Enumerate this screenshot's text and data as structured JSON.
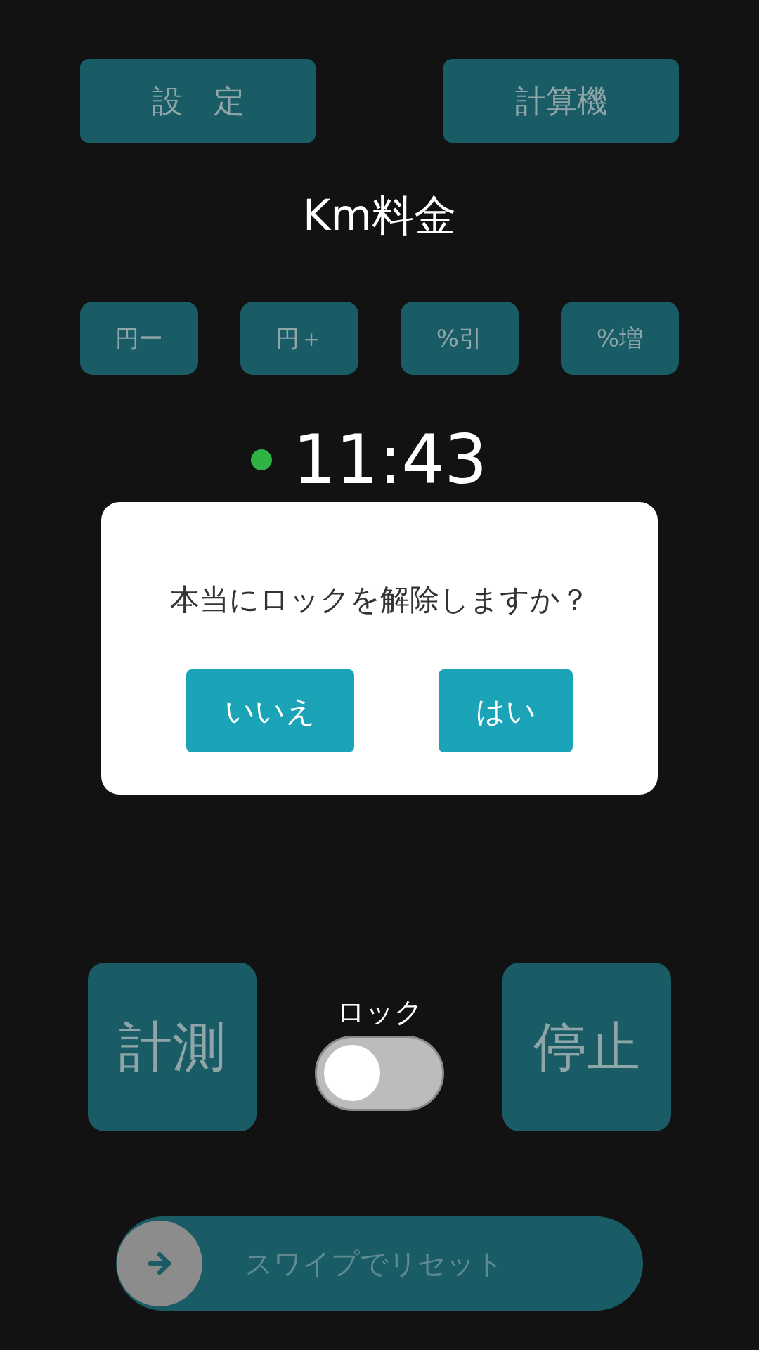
{
  "top_buttons": [
    {
      "label": "設　定"
    },
    {
      "label": "計算機"
    }
  ],
  "title": "Km料金",
  "adjust_buttons": [
    {
      "label": "円ー"
    },
    {
      "label": "円＋"
    },
    {
      "label": "%引"
    },
    {
      "label": "%増"
    }
  ],
  "clock": {
    "time": "11:43",
    "active": true
  },
  "dialog": {
    "message": "本当にロックを解除しますか？",
    "buttons": [
      {
        "label": "いいえ"
      },
      {
        "label": "はい"
      }
    ]
  },
  "measure_button": "計測",
  "stop_button": "停止",
  "lock": {
    "label": "ロック",
    "on": false
  },
  "swipe": {
    "label": "スワイプでリセット",
    "level": 0
  }
}
